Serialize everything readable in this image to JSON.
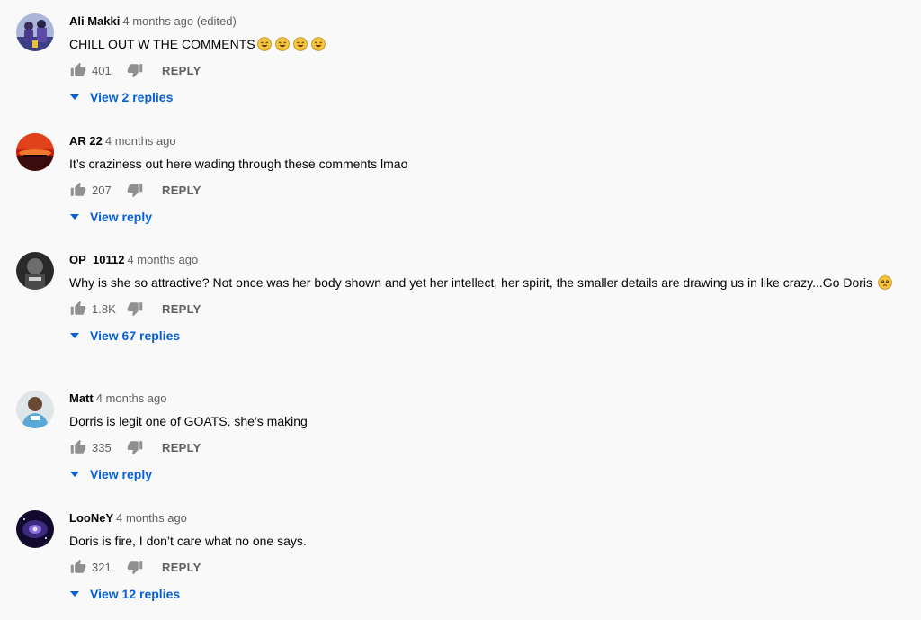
{
  "colors": {
    "background": "#f9f9f9",
    "text": "#030303",
    "meta": "#606060",
    "link": "#065fd4",
    "emoji": "#f6c33d"
  },
  "icons": {
    "like": "thumb-up-icon",
    "dislike": "thumb-down-icon",
    "expand": "caret-down-icon",
    "emoji": "rolling-on-floor-laughing-emoji-icon",
    "emoji_pleading": "pleading-face-emoji-icon"
  },
  "comments": [
    {
      "author": "Ali Makki",
      "time": "4 months ago (edited)",
      "text": "CHILL OUT W THE COMMENTS",
      "likes": "401",
      "reply_label": "REPLY",
      "view_replies": "View 2 replies"
    },
    {
      "author": "AR 22",
      "time": "4 months ago",
      "text": "It’s craziness out here wading through these comments lmao",
      "likes": "207",
      "reply_label": "REPLY",
      "view_replies": "View reply"
    },
    {
      "author": "OP_10112",
      "time": "4 months ago",
      "text": "Why is she so attractive? Not once was her body shown and yet her intellect, her spirit, the smaller details are drawing us in like crazy...Go Doris",
      "likes": "1.8K",
      "reply_label": "REPLY",
      "view_replies": "View 67 replies"
    },
    {
      "author": "Matt",
      "time": "4 months ago",
      "text": "Dorris is legit one of GOATS. she’s making",
      "likes": "335",
      "reply_label": "REPLY",
      "view_replies": "View reply"
    },
    {
      "author": "LooNeY",
      "time": "4 months ago",
      "text": "Doris is fire, I don’t care what no one says.",
      "likes": "321",
      "reply_label": "REPLY",
      "view_replies": "View 12 replies"
    }
  ]
}
